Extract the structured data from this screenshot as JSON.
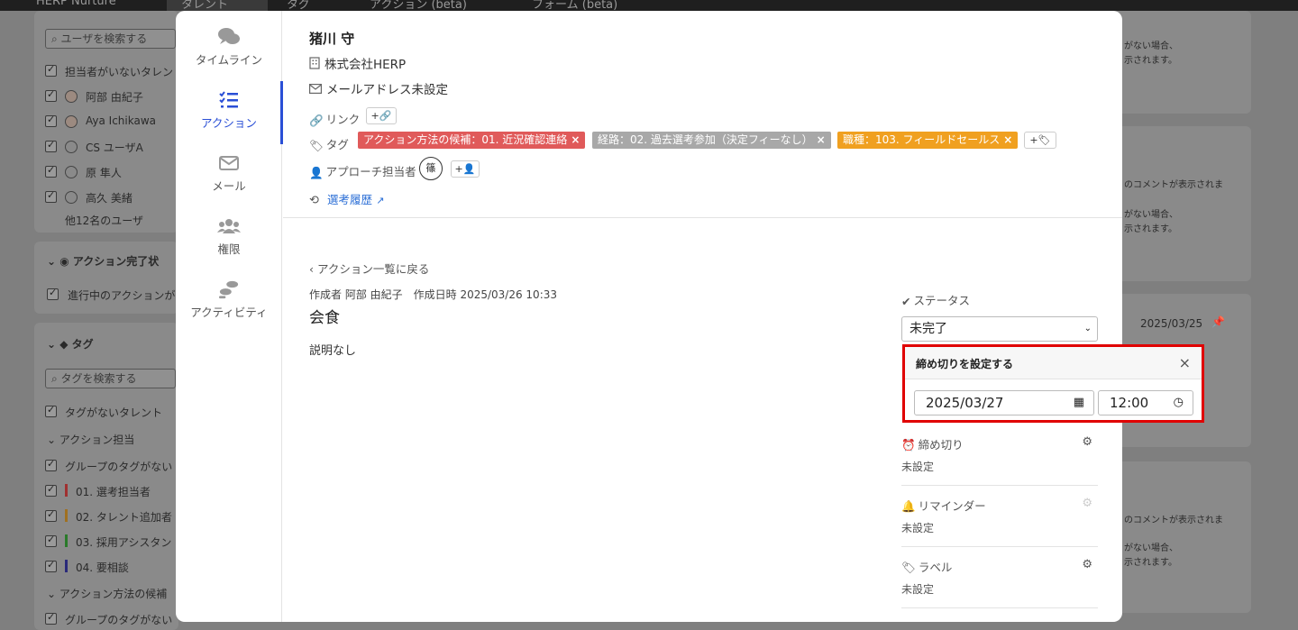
{
  "topbar": {
    "brand": "HERP Nurture",
    "nav": [
      "タレント",
      "タグ",
      "アクション (beta)",
      "フォーム (beta)"
    ]
  },
  "background": {
    "search_users_placeholder": "ユーザを検索する",
    "user_filters": [
      "担当者がいないタレン",
      "阿部 由紀子",
      "Aya Ichikawa",
      "CS ユーザA",
      "原 隼人",
      "高久 美緒"
    ],
    "more_users": "他12名のユーザ",
    "section_action_status": "アクション完了状",
    "status_filter": "進行中のアクションが",
    "section_tags": "タグ",
    "search_tags_placeholder": "タグを検索する",
    "tag_filters": [
      "タグがないタレント"
    ],
    "group_action_owner": "アクション担当",
    "group_items": [
      "グループのタグがない",
      "01. 選考担当者",
      "02. タレント追加者",
      "03. 採用アシスタン",
      "04. 要相談"
    ],
    "group_action_method": "アクション方法の候補",
    "group_items2": [
      "グループのタグがない"
    ],
    "right_snippets": [
      "がない場合、",
      "示されます。",
      "のコメントが表示されま",
      "がない場合、",
      "示されます。",
      "2025/03/25",
      "のコメントが表示されま",
      "がない場合、",
      "示されます。"
    ]
  },
  "nav": {
    "items": [
      {
        "label": "タイムライン",
        "icon": "comments-icon"
      },
      {
        "label": "アクション",
        "icon": "task-list-icon"
      },
      {
        "label": "メール",
        "icon": "mail-icon"
      },
      {
        "label": "権限",
        "icon": "users-icon"
      },
      {
        "label": "アクティビティ",
        "icon": "footsteps-icon"
      }
    ]
  },
  "talent": {
    "name": "猪川 守",
    "company": "株式会社HERP",
    "email": "メールアドレス未設定",
    "link_label": "リンク",
    "link_add": "+",
    "tag_label": "タグ",
    "tags": [
      {
        "text": "アクション方法の候補：01. 近況確認連絡",
        "color": "#e05a5a"
      },
      {
        "text": "経路：02. 過去選考参加（決定フィーなし）",
        "color": "#a8a8a8"
      },
      {
        "text": "職種：103. フィールドセールス",
        "color": "#f0a020"
      }
    ],
    "tag_add": "+",
    "owner_label": "アプローチ担当者",
    "owner_avatar": "篠",
    "owner_add": "+",
    "history_link": "選考履歴"
  },
  "action": {
    "back_link": "アクション一覧に戻る",
    "meta": "作成者 阿部 由紀子　作成日時 2025/03/26 10:33",
    "title": "会食",
    "description": "説明なし"
  },
  "side": {
    "status_label": "ステータス",
    "status_value": "未完了",
    "deadline_popover": {
      "title": "締め切りを設定する",
      "date": "2025/03/27",
      "time": "12:00"
    },
    "deadline_label": "締め切り",
    "deadline_value": "未設定",
    "reminder_label": "リマインダー",
    "reminder_value": "未設定",
    "label_label": "ラベル",
    "label_value": "未設定"
  }
}
